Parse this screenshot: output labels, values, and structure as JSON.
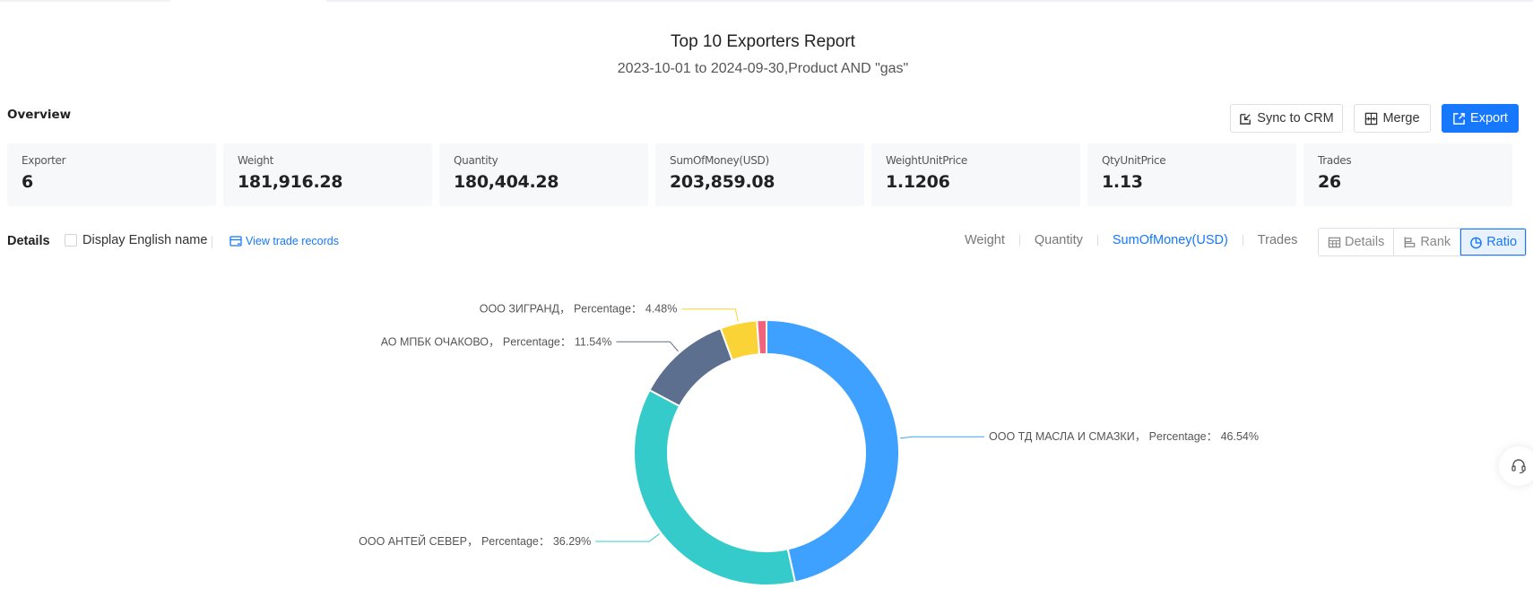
{
  "header": {
    "title": "Top 10 Exporters Report",
    "subtitle": "2023-10-01 to 2024-09-30,Product AND \"gas\""
  },
  "overview": {
    "label": "Overview",
    "buttons": {
      "sync": "Sync to CRM",
      "merge": "Merge",
      "export": "Export"
    },
    "cards": [
      {
        "label": "Exporter",
        "value": "6"
      },
      {
        "label": "Weight",
        "value": "181,916.28"
      },
      {
        "label": "Quantity",
        "value": "180,404.28"
      },
      {
        "label": "SumOfMoney(USD)",
        "value": "203,859.08"
      },
      {
        "label": "WeightUnitPrice",
        "value": "1.1206"
      },
      {
        "label": "QtyUnitPrice",
        "value": "1.13"
      },
      {
        "label": "Trades",
        "value": "26"
      }
    ]
  },
  "details": {
    "label": "Details",
    "display_english_name": "Display English name",
    "display_english_checked": false,
    "view_trade_records": "View trade records",
    "metric_tabs": [
      {
        "label": "Weight",
        "active": false
      },
      {
        "label": "Quantity",
        "active": false
      },
      {
        "label": "SumOfMoney(USD)",
        "active": true
      },
      {
        "label": "Trades",
        "active": false
      }
    ],
    "view_modes": [
      {
        "label": "Details",
        "icon": "table-icon",
        "active": false
      },
      {
        "label": "Rank",
        "icon": "bar-rank-icon",
        "active": false
      },
      {
        "label": "Ratio",
        "icon": "pie-icon",
        "active": true
      }
    ]
  },
  "colors": {
    "accent": "#1677ff"
  },
  "chart_data": {
    "type": "pie",
    "variant": "donut",
    "title": "",
    "metric": "SumOfMoney(USD)",
    "label_template": "{name}， Percentage： {value}%",
    "slices": [
      {
        "name": "ООО ТД МАСЛА И СМАЗКИ",
        "value": 46.54,
        "color": "#3fa1ff",
        "show_label": true
      },
      {
        "name": "ООО АНТЕЙ СЕВЕР",
        "value": 36.29,
        "color": "#36cbcb",
        "show_label": true
      },
      {
        "name": "АО МПБК ОЧАКОВО",
        "value": 11.54,
        "color": "#5d6f8e",
        "show_label": true
      },
      {
        "name": "ООО ЗИГРАНД",
        "value": 4.48,
        "color": "#fad337",
        "show_label": true
      },
      {
        "name": "",
        "value": 1.15,
        "color": "#f2637b",
        "show_label": false
      }
    ],
    "start_angle": "top",
    "direction": "clockwise",
    "legend": "none"
  }
}
